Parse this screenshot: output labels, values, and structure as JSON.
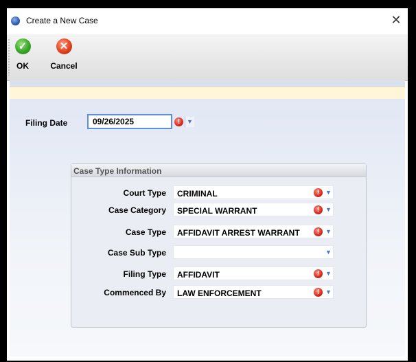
{
  "window": {
    "title": "Create a New Case",
    "close_glyph": "✕"
  },
  "toolbar": {
    "ok_label": "OK",
    "cancel_label": "Cancel"
  },
  "filing": {
    "label": "Filing Date",
    "value": "09/26/2025"
  },
  "case_group": {
    "title": "Case Type Information",
    "fields": [
      {
        "label": "Court Type",
        "value": "CRIMINAL",
        "required": true
      },
      {
        "label": "Case Category",
        "value": "SPECIAL WARRANT",
        "required": true
      },
      {
        "label": "Case Type",
        "value": "AFFIDAVIT ARREST WARRANT",
        "required": true
      },
      {
        "label": "Case Sub Type",
        "value": "",
        "required": false
      },
      {
        "label": "Filing Type",
        "value": "AFFIDAVIT",
        "required": true
      },
      {
        "label": "Commenced By",
        "value": "LAW ENFORCEMENT",
        "required": true
      }
    ]
  },
  "colors": {
    "accent": "#5f8fd6",
    "required": "#d9261a",
    "ok": "#3aa52a",
    "cancel": "#e2421d",
    "info_bar": "#fff5d8"
  },
  "icons": {
    "app": "app-globe-icon",
    "ok": "check-icon",
    "cancel": "x-icon",
    "required": "exclamation-icon",
    "dropdown": "triangle-down-icon"
  }
}
